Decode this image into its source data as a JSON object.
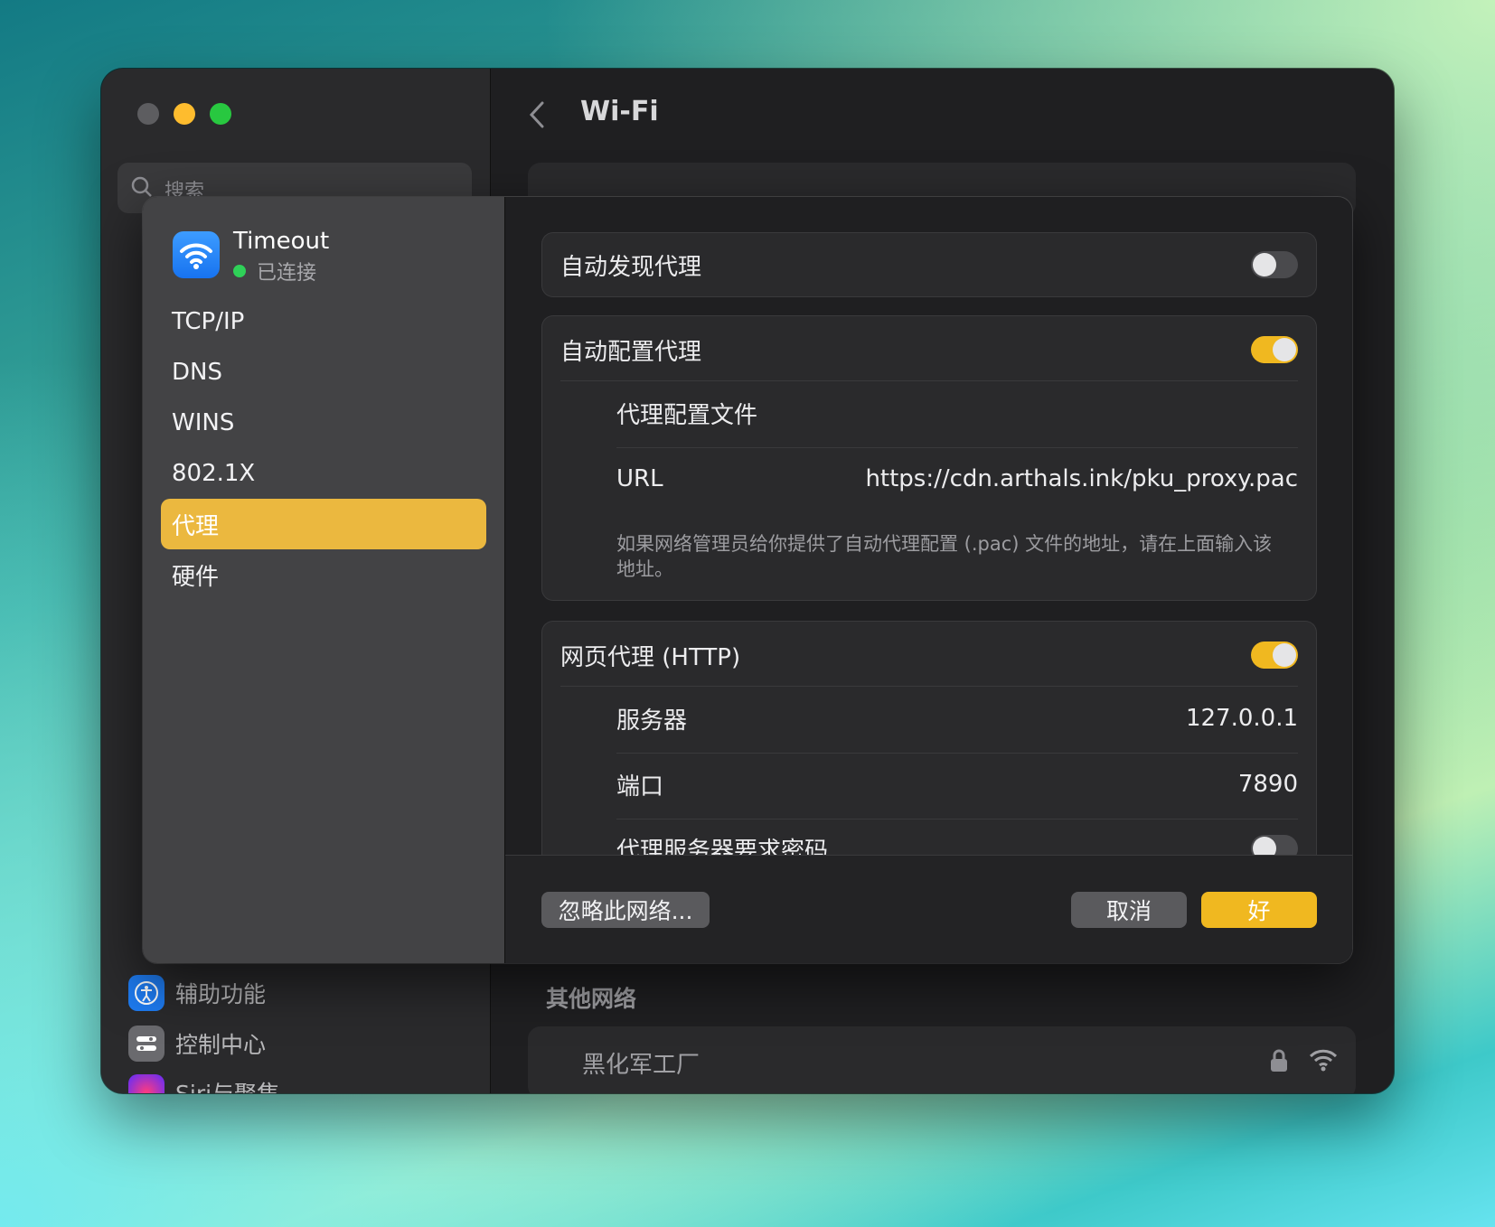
{
  "window": {
    "title": "Wi-Fi",
    "search_placeholder": "搜索",
    "sidebar_items": [
      {
        "label": "辅助功能",
        "icon": "accessibility-icon"
      },
      {
        "label": "控制中心",
        "icon": "control-center-icon"
      },
      {
        "label": "Siri与聚焦",
        "icon": "siri-icon"
      }
    ],
    "other_networks_title": "其他网络",
    "other_network": {
      "name": "黑化军工厂"
    }
  },
  "dialog": {
    "network_name": "Timeout",
    "network_status": "已连接",
    "nav": [
      {
        "label": "TCP/IP",
        "active": false
      },
      {
        "label": "DNS",
        "active": false
      },
      {
        "label": "WINS",
        "active": false
      },
      {
        "label": "802.1X",
        "active": false
      },
      {
        "label": "代理",
        "active": true
      },
      {
        "label": "硬件",
        "active": false
      }
    ],
    "auto_discovery": {
      "label": "自动发现代理",
      "enabled": false
    },
    "auto_config": {
      "label": "自动配置代理",
      "enabled": true,
      "file_label": "代理配置文件",
      "url_label": "URL",
      "url_value": "https://cdn.arthals.ink/pku_proxy.pac",
      "hint": "如果网络管理员给你提供了自动代理配置 (.pac) 文件的地址，请在上面输入该地址。"
    },
    "http_proxy": {
      "label": "网页代理 (HTTP)",
      "enabled": true,
      "server_label": "服务器",
      "server_value": "127.0.0.1",
      "port_label": "端口",
      "port_value": "7890",
      "auth_label": "代理服务器要求密码",
      "auth_enabled": false
    },
    "buttons": {
      "forget": "忽略此网络...",
      "cancel": "取消",
      "ok": "好"
    }
  },
  "colors": {
    "accent": "#f0b820",
    "nav_active": "#ebb83f",
    "connected": "#2fd158"
  }
}
